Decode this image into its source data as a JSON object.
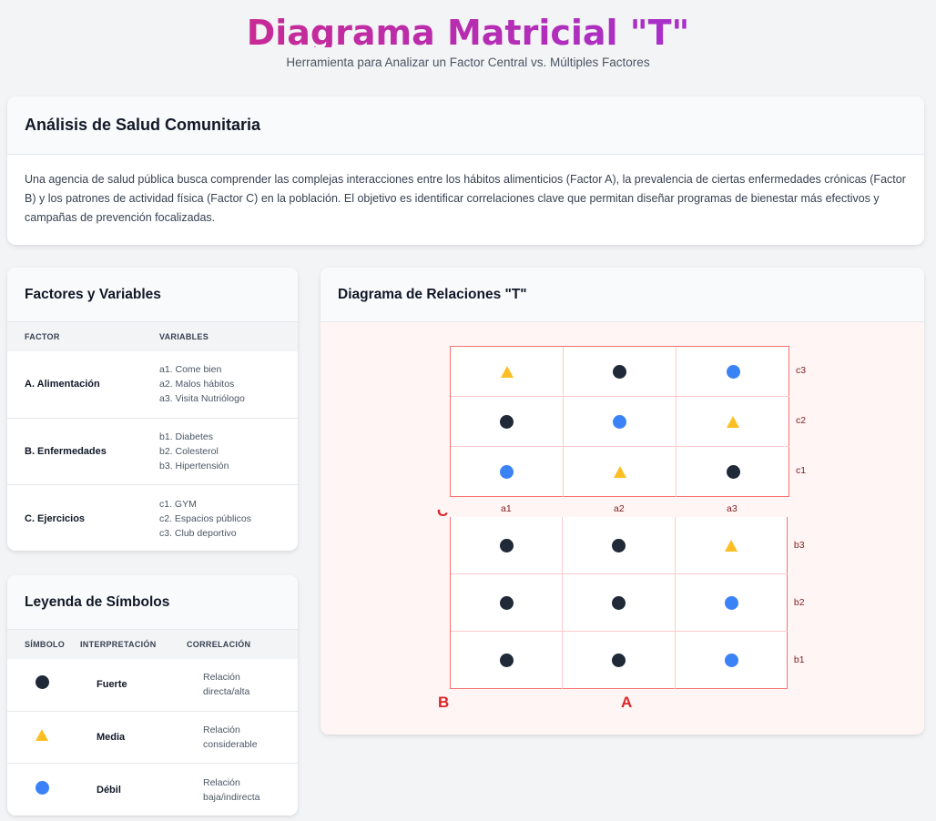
{
  "header": {
    "title": "Diagrama Matricial \"T\"",
    "subtitle": "Herramienta para Analizar un Factor Central vs. Múltiples Factores"
  },
  "intro": {
    "title": "Análisis de Salud Comunitaria",
    "text": "Una agencia de salud pública busca comprender las complejas interacciones entre los hábitos alimenticios (Factor A), la prevalencia de ciertas enfermedades crónicas (Factor B) y los patrones de actividad física (Factor C) en la población. El objetivo es identificar correlaciones clave que permitan diseñar programas de bienestar más efectivos y campañas de prevención focalizadas."
  },
  "factors": {
    "title": "Factores y Variables",
    "col_factor": "FACTOR",
    "col_vars": "VARIABLES",
    "rows": [
      {
        "name": "A. Alimentación",
        "vars": [
          "a1. Come bien",
          "a2. Malos hábitos",
          "a3. Visita Nutriólogo"
        ]
      },
      {
        "name": "B. Enfermedades",
        "vars": [
          "b1. Diabetes",
          "b2. Colesterol",
          "b3. Hipertensión"
        ]
      },
      {
        "name": "C. Ejercicios",
        "vars": [
          "c1. GYM",
          "c2. Espacios públicos",
          "c3. Club deportivo"
        ]
      }
    ]
  },
  "legend": {
    "title": "Leyenda de Símbolos",
    "col_symbol": "SÍMBOLO",
    "col_interp": "INTERPRETACIÓN",
    "col_corr": "CORRELACIÓN",
    "rows": [
      {
        "symbol": "strong-circle",
        "interp": "Fuerte",
        "corr": "Relación directa/alta"
      },
      {
        "symbol": "medium-triangle",
        "interp": "Media",
        "corr": "Relación considerable"
      },
      {
        "symbol": "weak-circle",
        "interp": "Débil",
        "corr": "Relación baja/indirecta"
      }
    ],
    "colors": {
      "strong": "#1f2937",
      "medium": "#fbbf24",
      "weak": "#3b82f6"
    }
  },
  "diagram": {
    "title": "Diagrama de Relaciones \"T\"",
    "columns": [
      "a1",
      "a2",
      "a3"
    ],
    "top_rows": [
      {
        "label": "c3",
        "cells": [
          "M",
          "S",
          "W"
        ]
      },
      {
        "label": "c2",
        "cells": [
          "S",
          "W",
          "M"
        ]
      },
      {
        "label": "c1",
        "cells": [
          "W",
          "M",
          "S"
        ]
      }
    ],
    "bottom_rows": [
      {
        "label": "b3",
        "cells": [
          "S",
          "S",
          "M"
        ]
      },
      {
        "label": "b2",
        "cells": [
          "S",
          "S",
          "W"
        ]
      },
      {
        "label": "b1",
        "cells": [
          "S",
          "S",
          "W"
        ]
      }
    ],
    "axis_b": "B",
    "axis_a": "A",
    "axis_c": "C"
  }
}
